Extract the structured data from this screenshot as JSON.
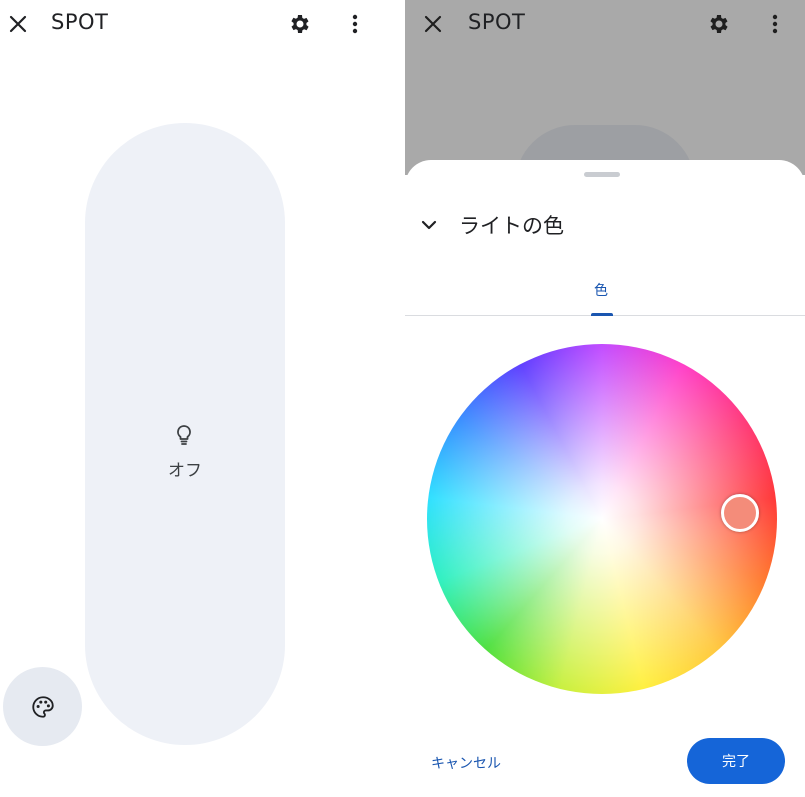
{
  "left_screen": {
    "title": "SPOT",
    "light_state": "オフ",
    "icons": [
      "close-icon",
      "gear-icon",
      "more-vert-icon",
      "lightbulb-icon",
      "palette-icon"
    ]
  },
  "right_screen": {
    "title": "SPOT",
    "sheet": {
      "title": "ライトの色",
      "tabs": [
        {
          "label": "色",
          "selected": true
        }
      ],
      "color_wheel": {
        "selected_color": "#f48c7a"
      },
      "cancel_label": "キャンセル",
      "done_label": "完了"
    },
    "icons": [
      "close-icon",
      "gear-icon",
      "more-vert-icon",
      "chevron-down-icon"
    ]
  },
  "colors": {
    "accent": "#1a56b0",
    "primary_button": "#1565d8",
    "pill_bg": "#eef1f7",
    "scrim": "#a9a9a9"
  }
}
